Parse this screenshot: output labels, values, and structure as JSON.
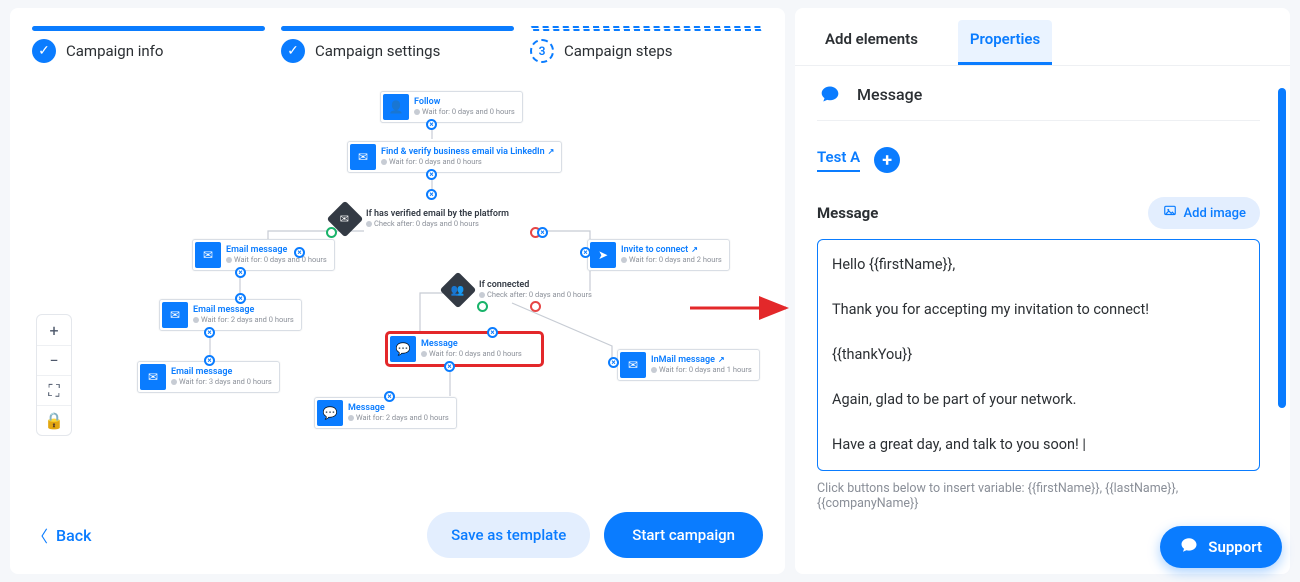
{
  "stepper": {
    "items": [
      {
        "label": "Campaign info",
        "done": true
      },
      {
        "label": "Campaign settings",
        "done": true
      },
      {
        "label": "Campaign steps",
        "done": false,
        "num": "3"
      }
    ]
  },
  "zoom": {
    "plus": "+",
    "minus": "−",
    "fit": "⛶",
    "lock": "🔒"
  },
  "footer": {
    "back": "Back",
    "save_tpl": "Save as template",
    "start": "Start campaign"
  },
  "flow": {
    "follow": {
      "title": "Follow",
      "sub": "Wait for: 0 days and 0 hours",
      "icon": "follow-icon"
    },
    "find_email": {
      "title": "Find & verify business email via LinkedIn",
      "sub": "Wait for: 0 days and 0 hours",
      "icon": "verify-email-icon",
      "ext": true
    },
    "cond_verified": {
      "title": "If has verified email by the platform",
      "sub": "Check after: 0 days and 0 hours"
    },
    "email1": {
      "title": "Email message",
      "sub": "Wait for: 0 days and 0 hours",
      "icon": "email-icon"
    },
    "email2": {
      "title": "Email message",
      "sub": "Wait for: 2 days and 0 hours",
      "icon": "email-icon"
    },
    "email3": {
      "title": "Email message",
      "sub": "Wait for: 3 days and 0 hours",
      "icon": "email-icon"
    },
    "invite": {
      "title": "Invite to connect",
      "sub": "Wait for: 0 days and 2 hours",
      "icon": "invite-icon",
      "ext": true
    },
    "cond_conn": {
      "title": "If connected",
      "sub": "Check after: 0 days and 0 hours"
    },
    "msg1": {
      "title": "Message",
      "sub": "Wait for: 0 days and 0 hours",
      "icon": "message-icon"
    },
    "inmail": {
      "title": "InMail message",
      "sub": "Wait for: 0 days and 1 hours",
      "icon": "inmail-icon",
      "ext": true
    },
    "msg2": {
      "title": "Message",
      "sub": "Wait for: 2 days and 0 hours",
      "icon": "message-icon"
    }
  },
  "panel": {
    "tabs": {
      "add": "Add elements",
      "props": "Properties"
    },
    "type_label": "Message",
    "ab": {
      "variant": "Test A"
    },
    "msg_header": "Message",
    "add_image": "Add image",
    "message_text": "Hello {{firstName}},\n\nThank you for accepting my invitation to connect!\n\n{{thankYou}}\n\nAgain, glad to be part of your network.\n\nHave a great day, and talk to you soon! |",
    "hint": "Click buttons below to insert variable: {{firstName}}, {{lastName}}, {{companyName}}"
  },
  "support": "Support"
}
